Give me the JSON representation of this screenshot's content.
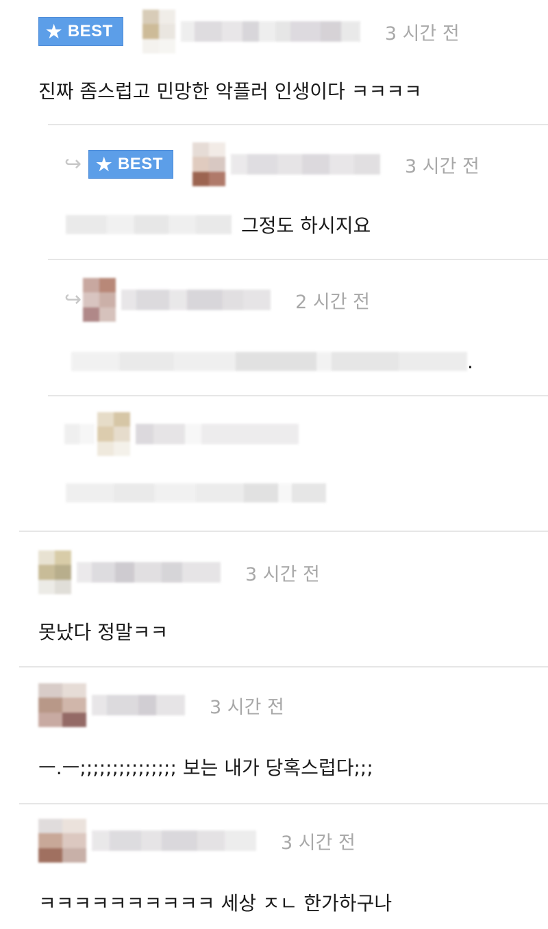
{
  "badge": {
    "label": "BEST"
  },
  "comments": [
    {
      "time": "3 시간 전",
      "text": "진짜 좀스럽고 민망한 악플러 인생이다 ㅋㅋㅋㅋ"
    },
    {
      "time": "3 시간 전",
      "text": "그정도 하시지요"
    },
    {
      "time": "2 시간 전",
      "text": "."
    },
    {
      "time": "",
      "text": ""
    },
    {
      "time": "3 시간 전",
      "text": "못났다 정말ㅋㅋ"
    },
    {
      "time": "3 시간 전",
      "text": "ㅡ.ㅡ;;;;;;;;;;;;;;; 보는 내가 당혹스럽다;;;"
    },
    {
      "time": "3 시간 전",
      "text": "ㅋㅋㅋㅋㅋㅋㅋㅋㅋㅋ 세상 ㅈㄴ 한가하구나"
    }
  ],
  "icons": {
    "star": "star-icon",
    "reply": "reply-arrow-icon",
    "avatar": "avatar"
  },
  "colors": {
    "best_badge": "#5c9ee8",
    "time": "#a8a8a8",
    "divider": "#e6e6e6"
  }
}
